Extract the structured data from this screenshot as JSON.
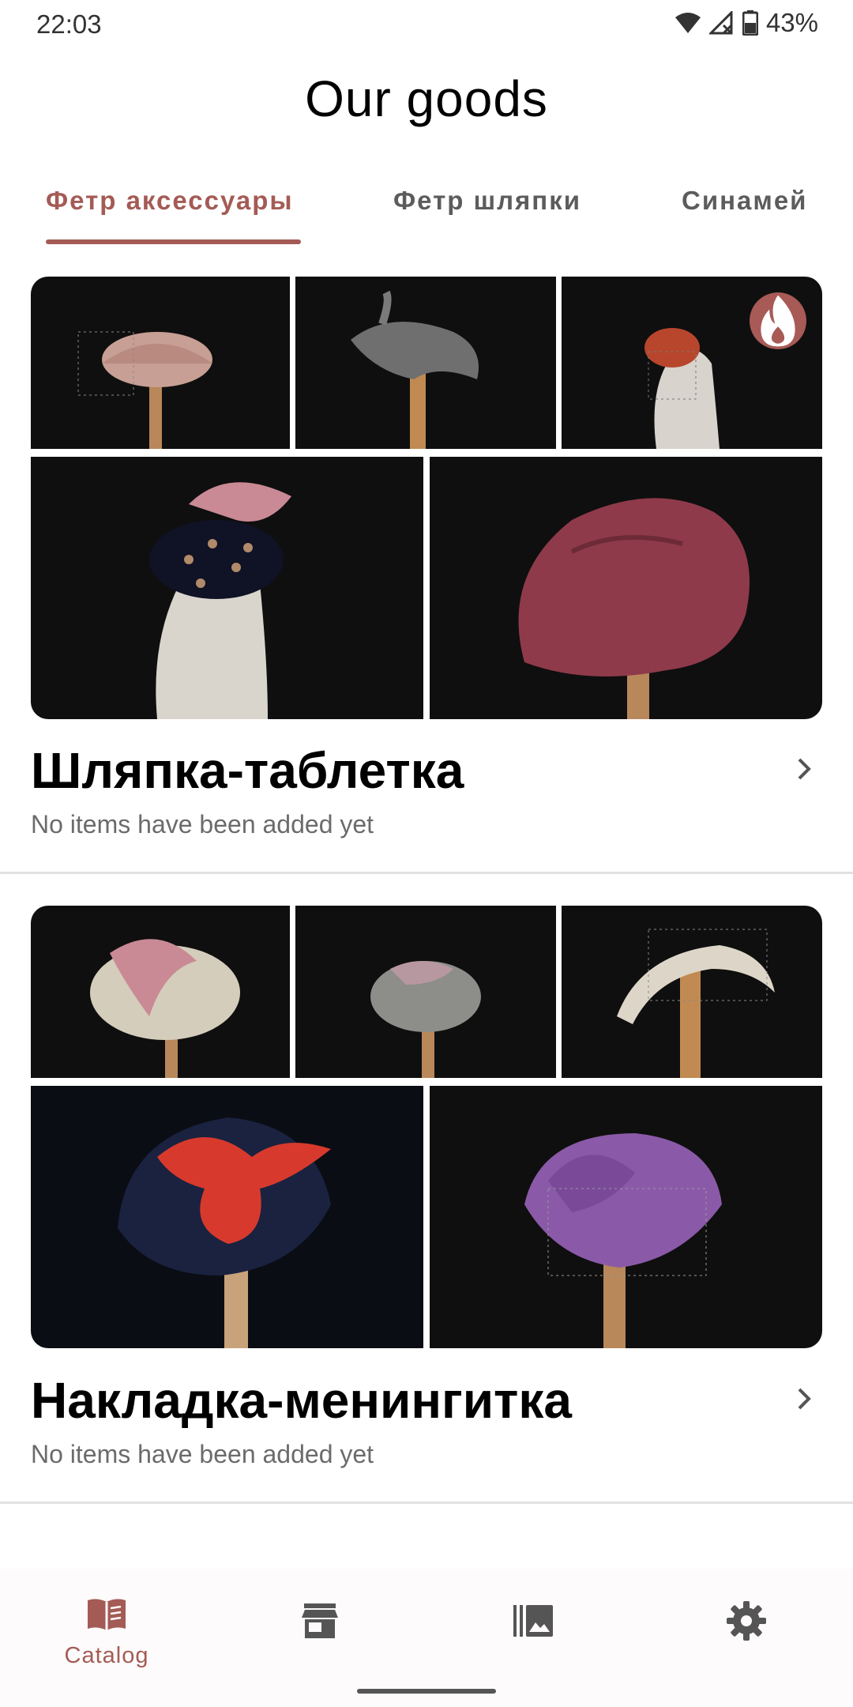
{
  "status_bar": {
    "time": "22:03",
    "battery": "43%",
    "icons": [
      "wifi-icon",
      "cell-signal-icon",
      "battery-icon"
    ]
  },
  "header": {
    "title": "Our goods"
  },
  "tabs": [
    {
      "label": "Фетр аксессуары",
      "active": true
    },
    {
      "label": "Фетр шляпки",
      "active": false
    },
    {
      "label": "Синамей",
      "active": false
    }
  ],
  "categories": [
    {
      "title": "Шляпка-таблетка",
      "subtitle": "No items have been added yet",
      "images": [
        "pink felt hat with veil",
        "grey felt hat",
        "rust fascinator with veil",
        "black pillbox with pearls",
        "burgundy draped felt hat"
      ],
      "badge_icon": "fire-icon"
    },
    {
      "title": "Накладка-менингитка",
      "subtitle": "No items have been added yet",
      "images": [
        "pink and beige headpiece",
        "grey headpiece with veil",
        "beige headband with veil",
        "navy headpiece with red rose",
        "purple headpiece with veil"
      ]
    }
  ],
  "bottom_nav": [
    {
      "label": "Catalog",
      "icon": "book-icon",
      "active": true
    },
    {
      "label": "",
      "icon": "store-icon",
      "active": false
    },
    {
      "label": "",
      "icon": "gallery-icon",
      "active": false
    },
    {
      "label": "",
      "icon": "gear-icon",
      "active": false
    }
  ],
  "colors": {
    "accent": "#a45b55",
    "text": "#111111",
    "muted": "#6b6b6b",
    "photo_background": "#0f0f0f"
  }
}
